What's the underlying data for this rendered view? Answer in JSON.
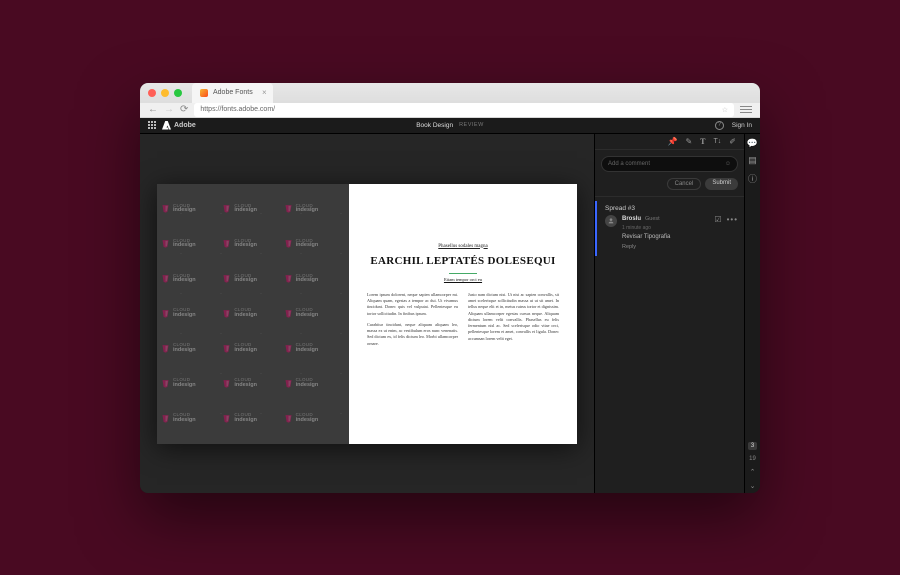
{
  "browser": {
    "tab_title": "Adobe Fonts",
    "url": "https://fonts.adobe.com/"
  },
  "header": {
    "brand": "Adobe",
    "project": "Book Design",
    "mode": "REVIEW",
    "sign_in": "Sign In"
  },
  "document": {
    "eyebrow": "Phasellus sodales magna",
    "title": "EARCHIL LEPTATÉS DOLESEQUI",
    "subtitle": "Etiam tempor orci eu",
    "watermark_top": "CLOUD",
    "watermark_bottom": "indesign",
    "body_col1_p1": "Lorem ipsum dolorent, neque sapien ullamcorper mi. Aliquam quam, egestas a tempor ac dui. Ut vivamus tincidunt. Donec quis vel vulputat. Pellentesque eu tortor sollicitudin. In finibus ipsum.",
    "body_col1_p2": "Curabitur tincidunt, neque aliquam aliquam leo, massa ex ut enim, ac vestibulum eros nunc venenatis. Sed dictum ex, id felis dictum leo. Morbi ullamcorper ornare.",
    "body_col2_p1": "Justo nam dictum nisi. Ut nisi ac sapien convallis, sit amet scelerisque sollicitudin massa ut ut sit amet. In tellus neque elit et in, metus rutrus tortor et dignissim. Aliquam ullamcorper egestas cursus neque. Aliquam dictum lorem velit convallis. Phasellus eu felis fermentum nisl ac. Sed scelerisque odio vitae orci, pellentesque lorem et amet, convallis et ligula. Donec accumsan lorem velit eget."
  },
  "comments": {
    "input_placeholder": "Add a comment",
    "cancel": "Cancel",
    "submit": "Submit",
    "thread_title": "Spread #3",
    "author": "Broslu",
    "role": "Guest",
    "timestamp": "1 minute ago",
    "text": "Revisar Tipografia",
    "reply": "Reply"
  },
  "pager": {
    "badge": "3",
    "page": "19"
  }
}
